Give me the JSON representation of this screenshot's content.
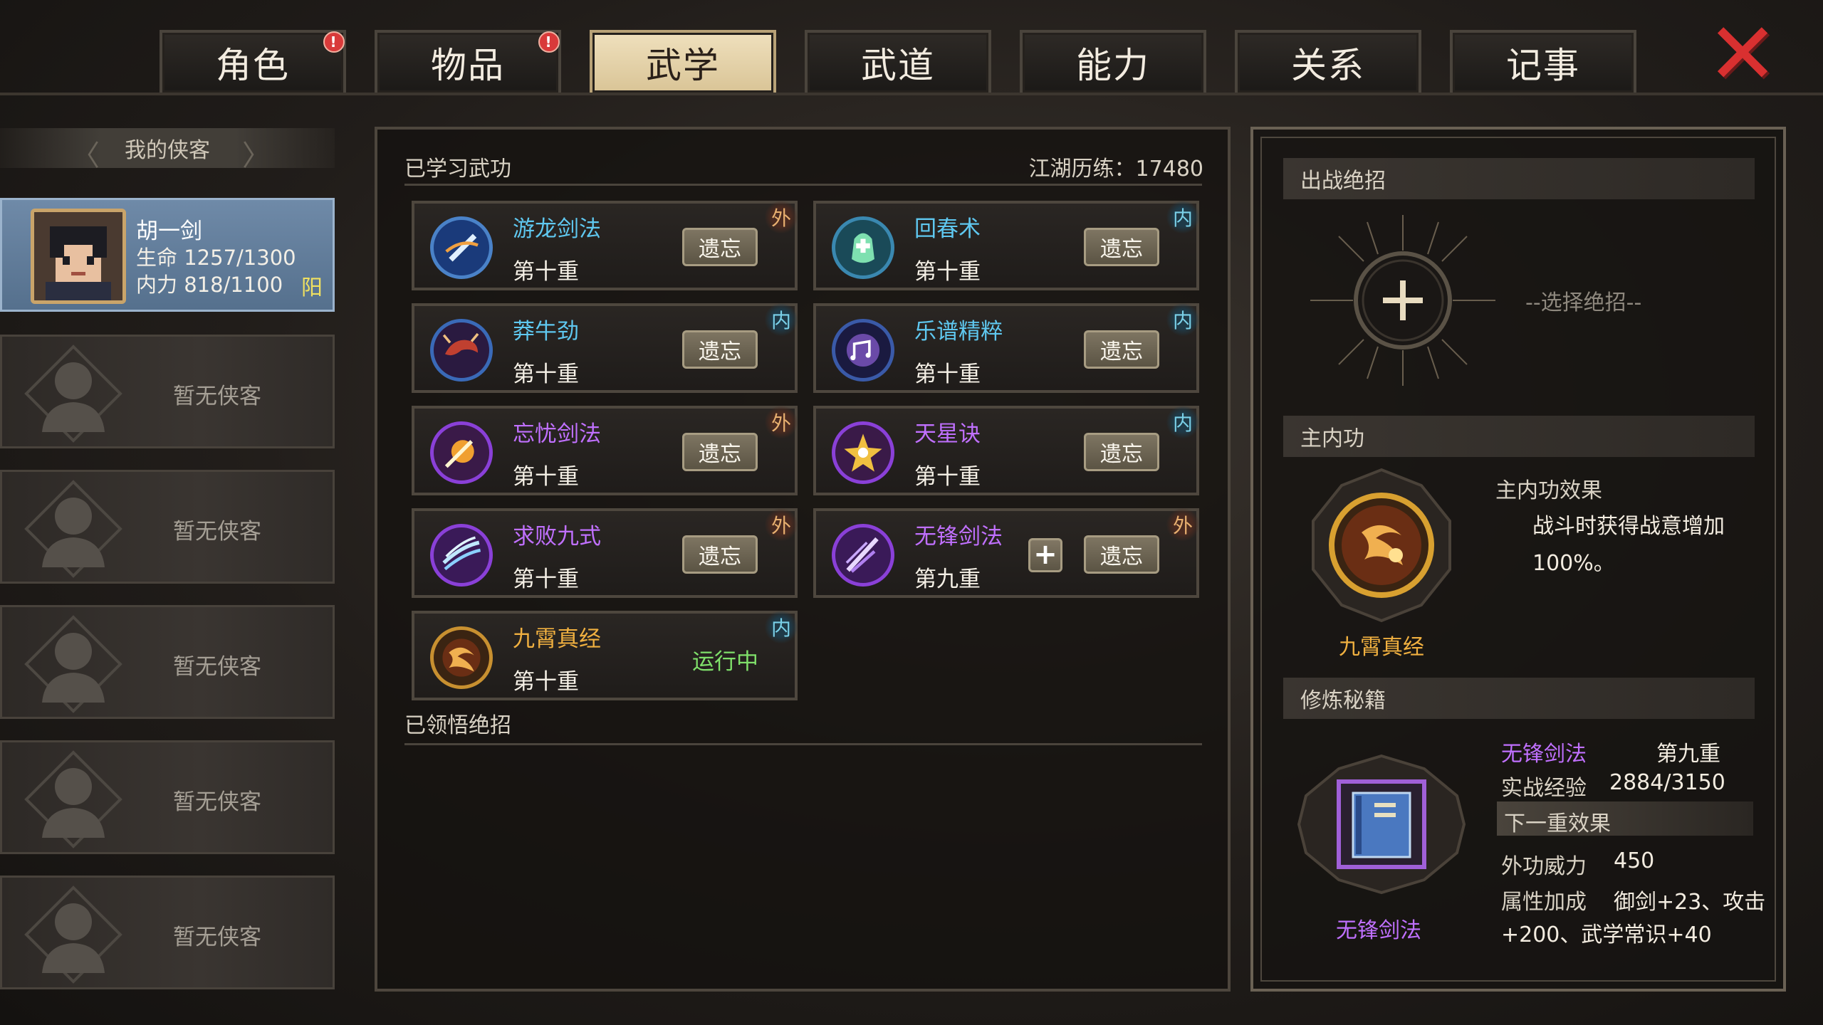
{
  "tabs": [
    {
      "label": "角色",
      "alert": "!"
    },
    {
      "label": "物品",
      "alert": "!"
    },
    {
      "label": "武学",
      "active": true
    },
    {
      "label": "武道"
    },
    {
      "label": "能力"
    },
    {
      "label": "关系"
    },
    {
      "label": "记事"
    }
  ],
  "sidebar": {
    "header": "我的侠客",
    "hero": {
      "name": "胡一剑",
      "hp": "生命 1257/1300",
      "mp": "内力 818/1100",
      "attr": "阳"
    },
    "empty_label": "暂无侠客",
    "empty_count": 5
  },
  "center": {
    "learned_title": "已学习武功",
    "exp_label": "江湖历练：17480",
    "understood_title": "已领悟绝招",
    "forget_label": "遗忘",
    "skills": [
      {
        "name": "游龙剑法",
        "level": "第十重",
        "type": "外",
        "color": "#5fc8f0",
        "icon": "sword-swirl-icon",
        "ring": "#4a82c8"
      },
      {
        "name": "回春术",
        "level": "第十重",
        "type": "内",
        "color": "#5fc8f0",
        "icon": "herb-potion-icon",
        "ring": "#3a88b0"
      },
      {
        "name": "莽牛劲",
        "level": "第十重",
        "type": "内",
        "color": "#5fc8f0",
        "icon": "bull-icon",
        "ring": "#3a6ab8"
      },
      {
        "name": "乐谱精粹",
        "level": "第十重",
        "type": "内",
        "color": "#5fc8f0",
        "icon": "music-score-icon",
        "ring": "#3a5aa8"
      },
      {
        "name": "忘忧剑法",
        "level": "第十重",
        "type": "外",
        "color": "#c070ff",
        "icon": "sword-burst-icon",
        "ring": "#8a40d8"
      },
      {
        "name": "天星诀",
        "level": "第十重",
        "type": "内",
        "color": "#c070ff",
        "icon": "star-icon",
        "ring": "#8a40d8"
      },
      {
        "name": "求败九式",
        "level": "第十重",
        "type": "外",
        "color": "#c070ff",
        "icon": "slash-icon",
        "ring": "#8a40d8"
      },
      {
        "name": "无锋剑法",
        "level": "第九重",
        "type": "外",
        "color": "#c070ff",
        "icon": "sword-slash-icon",
        "ring": "#8a40d8",
        "has_plus": true
      },
      {
        "name": "九霄真经",
        "level": "第十重",
        "type": "内",
        "color": "#f0b040",
        "icon": "fire-swirl-icon",
        "ring": "#c89030",
        "status": "运行中"
      }
    ]
  },
  "right": {
    "ultimate_title": "出战绝招",
    "select_ultimate": "--选择绝招--",
    "main_inner_title": "主内功",
    "main_inner_effect_title": "主内功效果",
    "main_inner_effect": "战斗时获得战意增加",
    "main_inner_effect_value": "100%。",
    "main_inner_name": "九霄真经",
    "training_title": "修炼秘籍",
    "training": {
      "name": "无锋剑法",
      "level": "第九重",
      "exp_label": "实战经验",
      "exp_value": "2884/3150",
      "next_label": "下一重效果",
      "power_label": "外功威力",
      "power_value": "450",
      "bonus_label": "属性加成",
      "bonus_value_line1": "御剑+23、攻击",
      "bonus_value_line2": "+200、武学常识+40",
      "book_name": "无锋剑法"
    }
  },
  "colors": {
    "purple": "#c070ff",
    "blue": "#5fc8f0",
    "gold": "#f0b040",
    "running_green": "#7fe06a",
    "close_red": "#d93030"
  }
}
